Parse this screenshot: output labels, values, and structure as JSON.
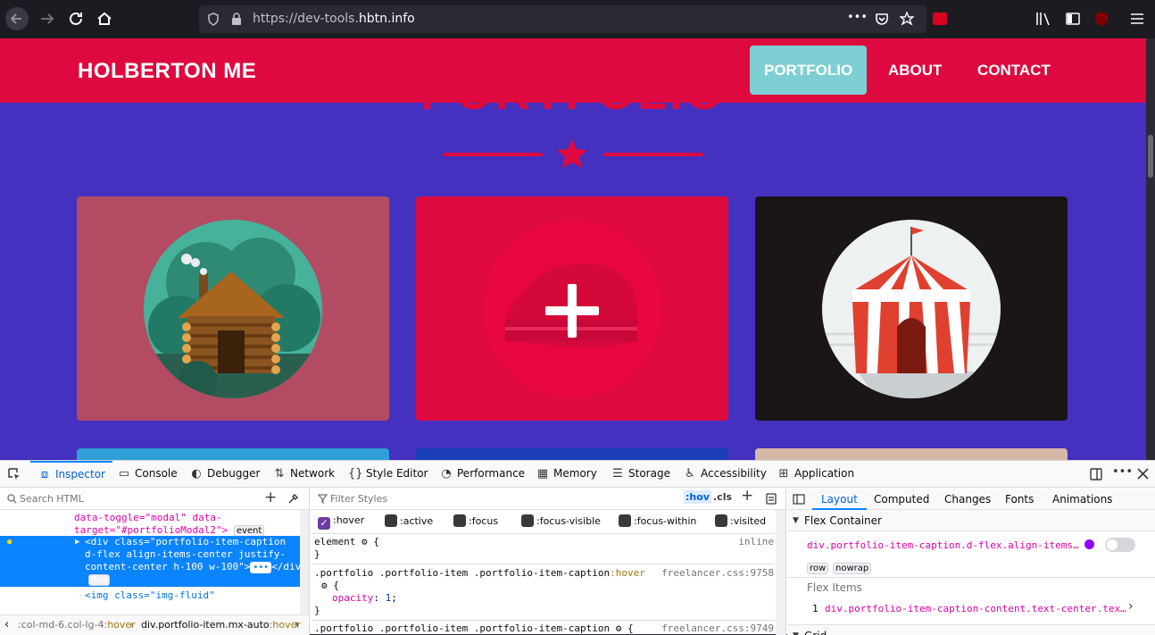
{
  "browser": {
    "url_prefix": "https://dev-tools.",
    "url_domain": "hbtn.info",
    "more_label": "•••"
  },
  "site": {
    "brand": "HOLBERTON ME",
    "nav": [
      {
        "label": "PORTFOLIO"
      },
      {
        "label": "ABOUT"
      },
      {
        "label": "CONTACT"
      }
    ],
    "section_title": "PORTFOLIO",
    "colors": {
      "navbar": "#de0a3f",
      "page_bg": "#4431bf",
      "active_link": "#7ecfd4"
    },
    "cards": [
      {
        "image": "log-cabin",
        "background": "#b34c63"
      },
      {
        "image": "plus-overlay",
        "background": "#de0a3f"
      },
      {
        "image": "circus-tent",
        "background": "#1a1516"
      }
    ]
  },
  "devtools": {
    "tabs": [
      {
        "label": "Inspector",
        "icon": "⧈"
      },
      {
        "label": "Console",
        "icon": "▭"
      },
      {
        "label": "Debugger",
        "icon": "◐"
      },
      {
        "label": "Network",
        "icon": "⇅"
      },
      {
        "label": "Style Editor",
        "icon": "{}"
      },
      {
        "label": "Performance",
        "icon": "◔"
      },
      {
        "label": "Memory",
        "icon": "▦"
      },
      {
        "label": "Storage",
        "icon": "☰"
      },
      {
        "label": "Accessibility",
        "icon": "♿"
      },
      {
        "label": "Application",
        "icon": "⊞"
      }
    ],
    "markup": {
      "search_placeholder": "Search HTML",
      "line1": "data-toggle=\"modal\" data-",
      "line2": "target=\"#portfolioModal2\">",
      "event_badge": "event",
      "sel1": "<div class=\"portfolio-item-caption",
      "sel2": "d-flex align-items-center justify-",
      "sel3": "content-center h-100 w-100\">",
      "sel3_end": "</div>",
      "ellipsis_badge": "•••",
      "flex_badge": "flex",
      "line_img": "<img class=\"img-fluid\"",
      "crumb1": ":col-md-6.col-lg-4",
      "crumb1_state": ":hover",
      "crumb2": "div.portfolio-item.mx-auto",
      "crumb2_state": ":hover"
    },
    "rules": {
      "filter_placeholder": "Filter Styles",
      "hov_label": ":hov",
      "cls_label": ".cls",
      "pseudo": [
        ":hover",
        ":active",
        ":focus",
        ":focus-visible",
        ":focus-within",
        ":visited"
      ],
      "element_label": "element",
      "element_src": "inline",
      "rule1_selector": ".portfolio .portfolio-item .portfolio-item-caption",
      "rule1_state": ":hover",
      "rule1_src": "freelancer.css:9758",
      "rule1_prop": "opacity",
      "rule1_val": "1",
      "rule2_selector": ".portfolio .portfolio-item .portfolio-item-caption",
      "rule2_src": "freelancer.css:9749"
    },
    "layout": {
      "tabs": [
        "Layout",
        "Computed",
        "Changes",
        "Fonts",
        "Animations"
      ],
      "flex_container_label": "Flex Container",
      "flex_container_selector": "div.portfolio-item-caption.d-flex.align-items…",
      "badge_row": "row",
      "badge_nowrap": "nowrap",
      "flex_items_label": "Flex Items",
      "flex_item_index": "1",
      "flex_item_selector": "div.portfolio-item-caption-content.text-center.tex…",
      "grid_label": "Grid"
    }
  }
}
